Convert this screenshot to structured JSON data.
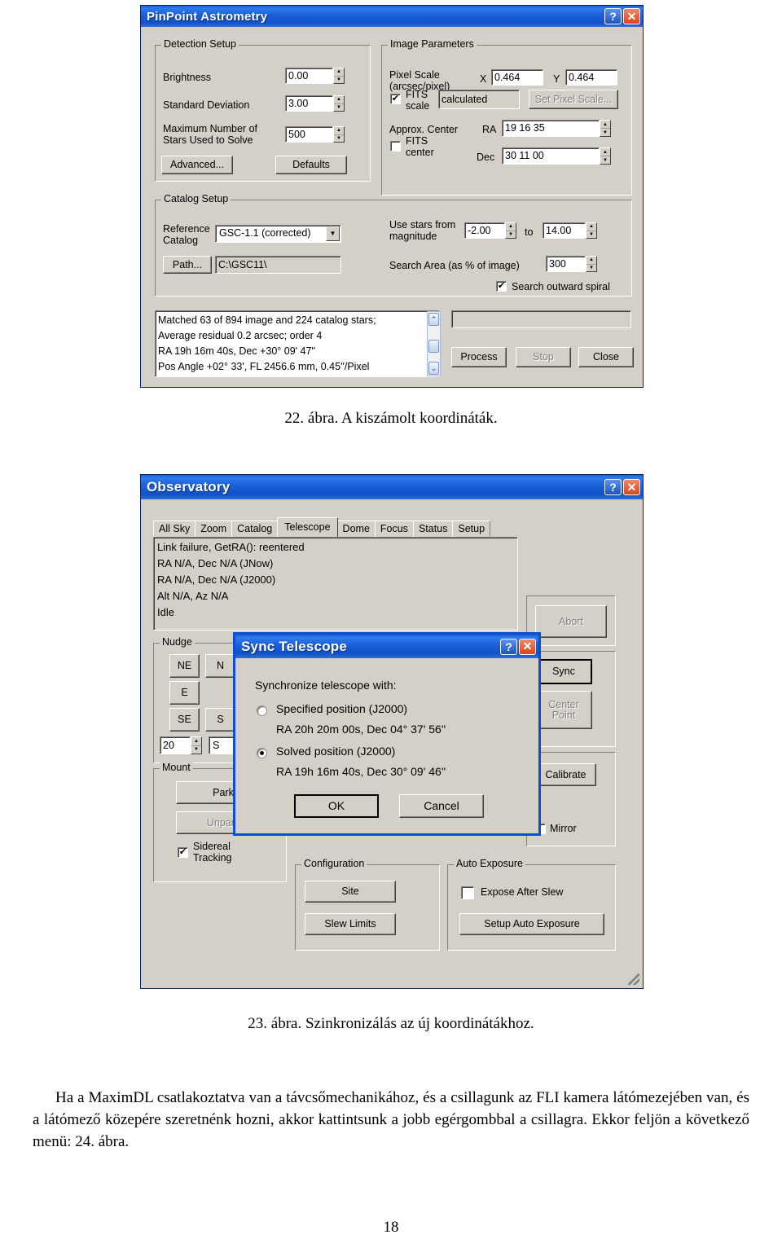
{
  "pinpoint": {
    "title": "PinPoint Astrometry",
    "help_icon": "?",
    "close_icon": "✕",
    "detection": {
      "legend": "Detection Setup",
      "brightness_label": "Brightness",
      "brightness_value": "0.00",
      "stddev_label": "Standard Deviation",
      "stddev_value": "3.00",
      "maxstars_label": "Maximum Number of\nStars Used to Solve",
      "maxstars_value": "500",
      "advanced_button": "Advanced...",
      "defaults_button": "Defaults"
    },
    "image_params": {
      "legend": "Image Parameters",
      "pixel_scale_label": "Pixel Scale\n(arcsec/pixel)",
      "x_label": "X",
      "x_value": "0.464",
      "y_label": "Y",
      "y_value": "0.464",
      "fits_scale_label": "FITS\nscale",
      "fits_scale_checked": true,
      "fits_scale_value": "calculated",
      "set_pixel_scale_button": "Set Pixel Scale...",
      "approx_center_label": "Approx. Center",
      "fits_center_label": "FITS\ncenter",
      "fits_center_checked": false,
      "ra_label": "RA",
      "ra_value": "19 16 35",
      "dec_label": "Dec",
      "dec_value": "30 11 00"
    },
    "catalog": {
      "legend": "Catalog Setup",
      "reference_catalog_label": "Reference\nCatalog",
      "reference_catalog_value": "GSC-1.1 (corrected)",
      "path_button": "Path...",
      "path_value": "C:\\GSC11\\",
      "use_stars_label": "Use stars from\nmagnitude",
      "mag_from": "-2.00",
      "to_label": "to",
      "mag_to": "14.00",
      "search_area_label": "Search Area (as % of image)",
      "search_area_value": "300",
      "spiral_label": "Search outward spiral",
      "spiral_checked": true
    },
    "results": {
      "lines": [
        "Matched 63 of 894 image and 224 catalog stars;",
        "Average residual 0.2 arcsec; order 4",
        "RA 19h 16m 40s,  Dec +30° 09' 47''",
        "Pos Angle +02° 33', FL 2456.6 mm, 0.45''/Pixel"
      ],
      "scroll_up_icon": "⌃",
      "scroll_down_icon": "⌄"
    },
    "progress_value": "",
    "process_button": "Process",
    "stop_button": "Stop",
    "close_button": "Close"
  },
  "caption22": "22. ábra. A kiszámolt koordináták.",
  "observatory": {
    "title": "Observatory",
    "help_icon": "?",
    "close_icon": "✕",
    "tabs": [
      {
        "label": "All Sky",
        "selected": false
      },
      {
        "label": "Zoom",
        "selected": false
      },
      {
        "label": "Catalog",
        "selected": false
      },
      {
        "label": "Telescope",
        "selected": true
      },
      {
        "label": "Dome",
        "selected": false
      },
      {
        "label": "Focus",
        "selected": false
      },
      {
        "label": "Status",
        "selected": false
      },
      {
        "label": "Setup",
        "selected": false
      }
    ],
    "status_lines": [
      "Link failure, GetRA(): reentered",
      "RA N/A, Dec N/A (JNow)",
      "RA N/A, Dec N/A (J2000)",
      "Alt N/A, Az N/A",
      "Idle"
    ],
    "abort_button": "Abort",
    "sync_button": "Sync",
    "center_button": "Center\nPoint",
    "calibrate_button": "Calibrate",
    "mirror_label": "Mirror",
    "nudge": {
      "legend": "Nudge",
      "ne": "NE",
      "n": "N",
      "e": "E",
      "se": "SE",
      "s": "S",
      "amount": "20",
      "unit": "S"
    },
    "mount": {
      "legend": "Mount",
      "park_button": "Park",
      "unpark_button": "Unpark",
      "sidereal_label": "Sidereal\nTracking",
      "sidereal_checked": true
    },
    "configuration": {
      "legend": "Configuration",
      "site_button": "Site",
      "slew_limits_button": "Slew Limits"
    },
    "auto_exposure": {
      "legend": "Auto Exposure",
      "expose_after_slew_label": "Expose After Slew",
      "expose_after_slew_checked": false,
      "setup_button": "Setup Auto Exposure"
    }
  },
  "sync_dialog": {
    "title": "Sync Telescope",
    "help_icon": "?",
    "close_icon": "✕",
    "prompt": "Synchronize telescope with:",
    "option1_label": "Specified position (J2000)",
    "option1_detail": "RA 20h 20m 00s, Dec 04° 37' 56''",
    "option1_selected": false,
    "option2_label": "Solved position (J2000)",
    "option2_detail": "RA 19h 16m 40s, Dec 30° 09' 46''",
    "option2_selected": true,
    "ok_button": "OK",
    "cancel_button": "Cancel"
  },
  "caption23": "23. ábra. Szinkronizálás az új koordinátákhoz.",
  "body_text": "Ha a MaximDL csatlakoztatva van a távcsőmechanikához, és a csillagunk az FLI ka­mera látómezejében van, és a látómező közepére szeretnénk hozni, akkor kattintsunk a jobb egérgombbal a csillagra. Ekkor feljön a következő menü: 24. ábra.",
  "page_number": "18"
}
